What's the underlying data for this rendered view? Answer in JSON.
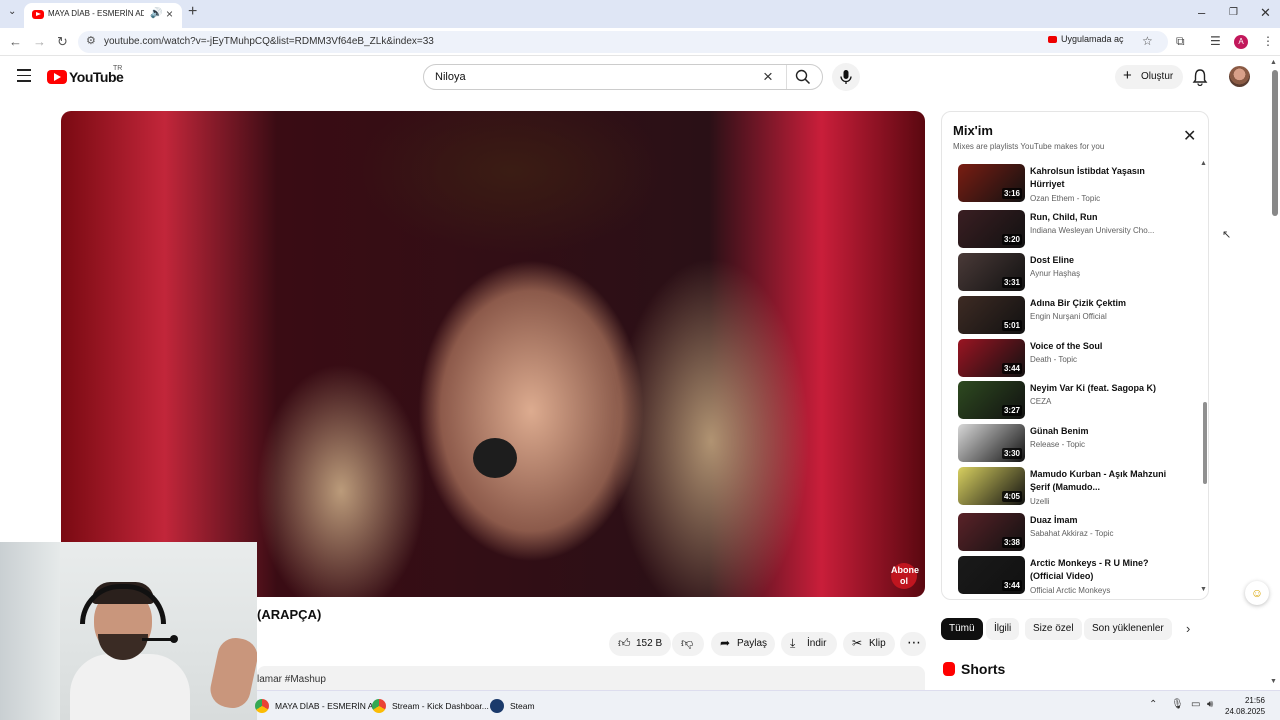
{
  "browser": {
    "tab_title": "MAYA DİAB - ESMERİN ADI",
    "url": "youtube.com/watch?v=-jEyTMuhpCQ&list=RDMM3Vf64eB_ZLk&index=33",
    "open_in_app": "Uygulamada aç",
    "profile_initial": "A"
  },
  "header": {
    "logo": "YouTube",
    "country": "TR",
    "search_query": "Niloya",
    "create_label": "Oluştur"
  },
  "video": {
    "title_visible": "(ARAPÇA)",
    "watermark": "Abone ol",
    "likes": "152 B",
    "share_label": "Paylaş",
    "download_label": "İndir",
    "clip_label": "Klip",
    "description_snippet": "lamar #Mashup"
  },
  "mix": {
    "title": "Mix'im",
    "subtitle": "Mixes are playlists YouTube makes for you",
    "items": [
      {
        "title": "Kahrolsun İstibdat Yaşasın Hürriyet",
        "channel": "Ozan Ethem - Topic",
        "duration": "3:16",
        "color": "#7a1d12"
      },
      {
        "title": "Run, Child, Run",
        "channel": "Indiana Wesleyan University Cho...",
        "duration": "3:20",
        "color": "#3a1e22"
      },
      {
        "title": "Dost Eline",
        "channel": "Aynur Haşhaş",
        "duration": "3:31",
        "color": "#4a3a38"
      },
      {
        "title": "Adına Bir Çizik Çektim",
        "channel": "Engin Nurşani Official",
        "duration": "5:01",
        "color": "#3e2b24"
      },
      {
        "title": "Voice of the Soul",
        "channel": "Death - Topic",
        "duration": "3:44",
        "color": "#9a1422"
      },
      {
        "title": "Neyim Var Ki (feat. Sagopa K)",
        "channel": "CEZA",
        "duration": "3:27",
        "color": "#2e4a20"
      },
      {
        "title": "Günah Benim",
        "channel": "Release - Topic",
        "duration": "3:30",
        "color": "#d8d8d8"
      },
      {
        "title": "Mamudo Kurban - Aşık Mahzuni Şerif (Mamudo...",
        "channel": "Uzelli",
        "duration": "4:05",
        "color": "#d8d060"
      },
      {
        "title": "Duaz İmam",
        "channel": "Sabahat Akkiraz - Topic",
        "duration": "3:38",
        "color": "#5a2228"
      },
      {
        "title": "Arctic Monkeys - R U Mine? (Official Video)",
        "channel": "Official Arctic Monkeys",
        "duration": "3:44",
        "color": "#1a1a1a"
      }
    ]
  },
  "chips": [
    "Tümü",
    "İlgili",
    "Size özel",
    "Son yüklenenler"
  ],
  "shorts_label": "Shorts",
  "taskbar": {
    "items": [
      {
        "label": "MAYA DİAB - ESMERİN A..."
      },
      {
        "label": "Stream - Kick Dashboar..."
      },
      {
        "label": "Steam"
      }
    ],
    "time": "21:56",
    "date": "24.08.2025"
  }
}
